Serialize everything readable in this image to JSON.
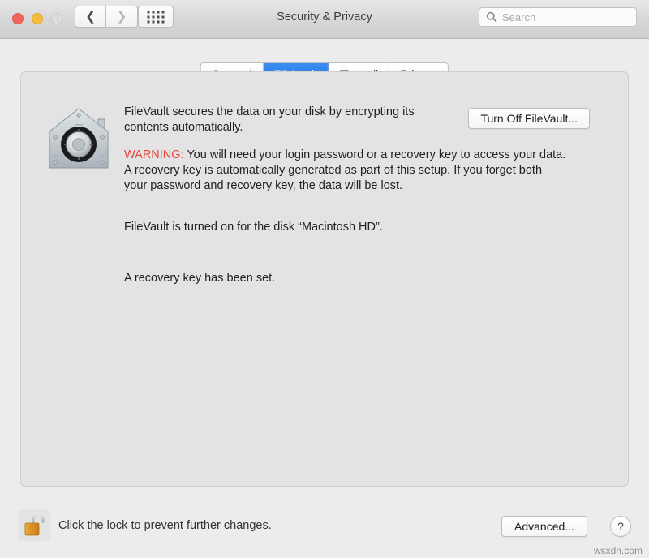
{
  "window": {
    "title": "Security & Privacy"
  },
  "toolbar": {
    "back_icon": "chevron-left-icon",
    "forward_icon": "chevron-right-icon",
    "show_all_icon": "grid-dots-icon",
    "close_button_color": "#f2655f",
    "minimize_button_color": "#f5bd3e",
    "zoom_button_color": "#dedede"
  },
  "search": {
    "placeholder": "Search",
    "value": "",
    "icon": "search-icon"
  },
  "tabs": [
    {
      "label": "General",
      "selected": false
    },
    {
      "label": "FileVault",
      "selected": true
    },
    {
      "label": "Firewall",
      "selected": false
    },
    {
      "label": "Privacy",
      "selected": false
    }
  ],
  "selected_tab": "FileVault",
  "accent_color": "#1d72e8",
  "warning_color": "#e8483d",
  "main": {
    "icon": "filevault-icon",
    "intro_text": "FileVault secures the data on your disk by encrypting its contents automatically.",
    "warning_label": "WARNING:",
    "warning_text": " You will need your login password or a recovery key to access your data. A recovery key is automatically generated as part of this setup. If you forget both your password and recovery key, the data will be lost.",
    "status_line_1": "FileVault is turned on for the disk “Macintosh HD”.",
    "status_line_2": "A recovery key has been set.",
    "turn_off_button": "Turn Off FileVault..."
  },
  "footer": {
    "lock_icon": "unlocked-padlock-icon",
    "lock_caption": "Click the lock to prevent further changes.",
    "advanced_button": "Advanced...",
    "help_button": "?"
  },
  "watermark": "wsxdn.com"
}
